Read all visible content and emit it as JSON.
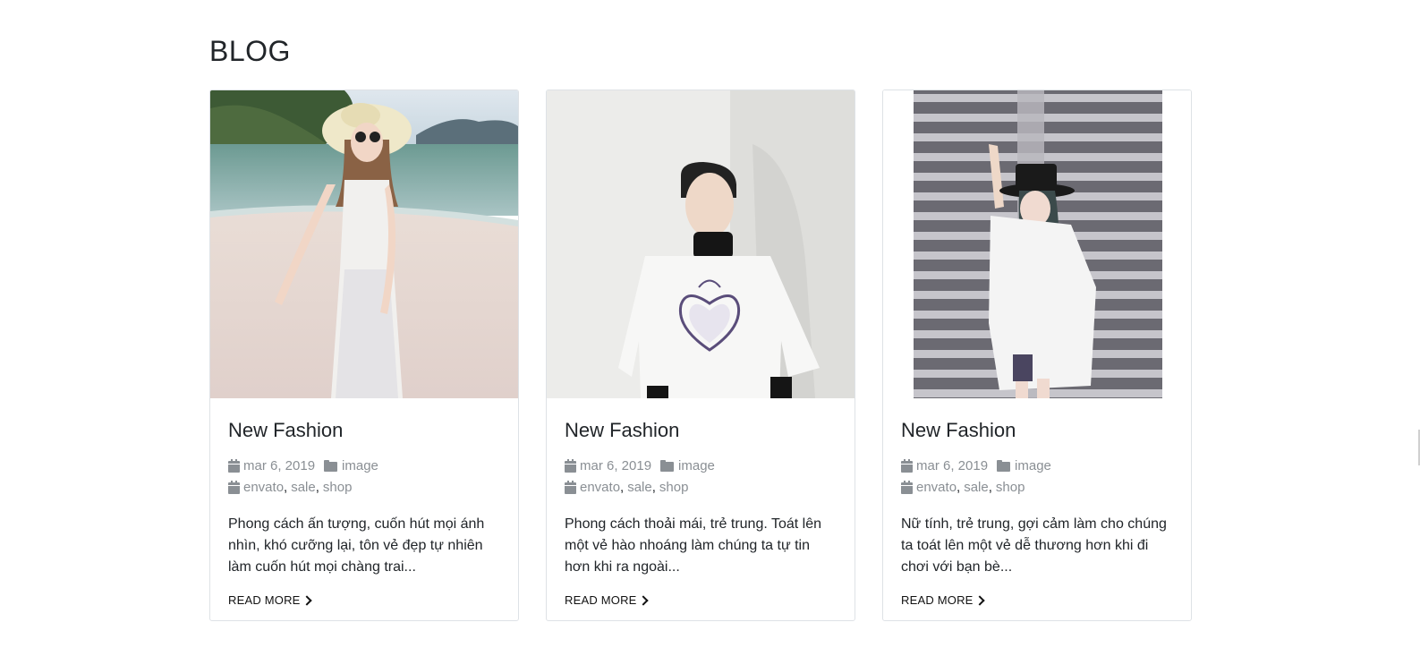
{
  "section": {
    "title": "BLOG"
  },
  "posts": [
    {
      "title": "New Fashion",
      "date": "mar 6, 2019",
      "category": "image",
      "tags": [
        "envato",
        "sale",
        "shop"
      ],
      "excerpt": "Phong cách ấn tượng, cuốn hút mọi ánh nhìn, khó cưỡng lại, tôn vẻ đẹp tự nhiên làm cuốn hút mọi chàng trai...",
      "read_more": "READ MORE"
    },
    {
      "title": "New Fashion",
      "date": "mar 6, 2019",
      "category": "image",
      "tags": [
        "envato",
        "sale",
        "shop"
      ],
      "excerpt": "Phong cách thoải mái, trẻ trung. Toát lên một vẻ hào nhoáng làm chúng ta tự tin hơn khi ra ngoài...",
      "read_more": "READ MORE"
    },
    {
      "title": "New Fashion",
      "date": "mar 6, 2019",
      "category": "image",
      "tags": [
        "envato",
        "sale",
        "shop"
      ],
      "excerpt": "Nữ tính, trẻ trung, gợi cảm làm cho chúng ta toát lên một vẻ dễ thương hơn khi đi chơi với bạn bè...",
      "read_more": "READ MORE"
    }
  ],
  "icons": {
    "date": "calendar-icon",
    "category": "folder-icon",
    "tags": "calendar-icon",
    "read_more": "chevron-right-icon"
  },
  "colors": {
    "text": "#212529",
    "meta": "#8a8f94",
    "border": "#dee2e6"
  }
}
